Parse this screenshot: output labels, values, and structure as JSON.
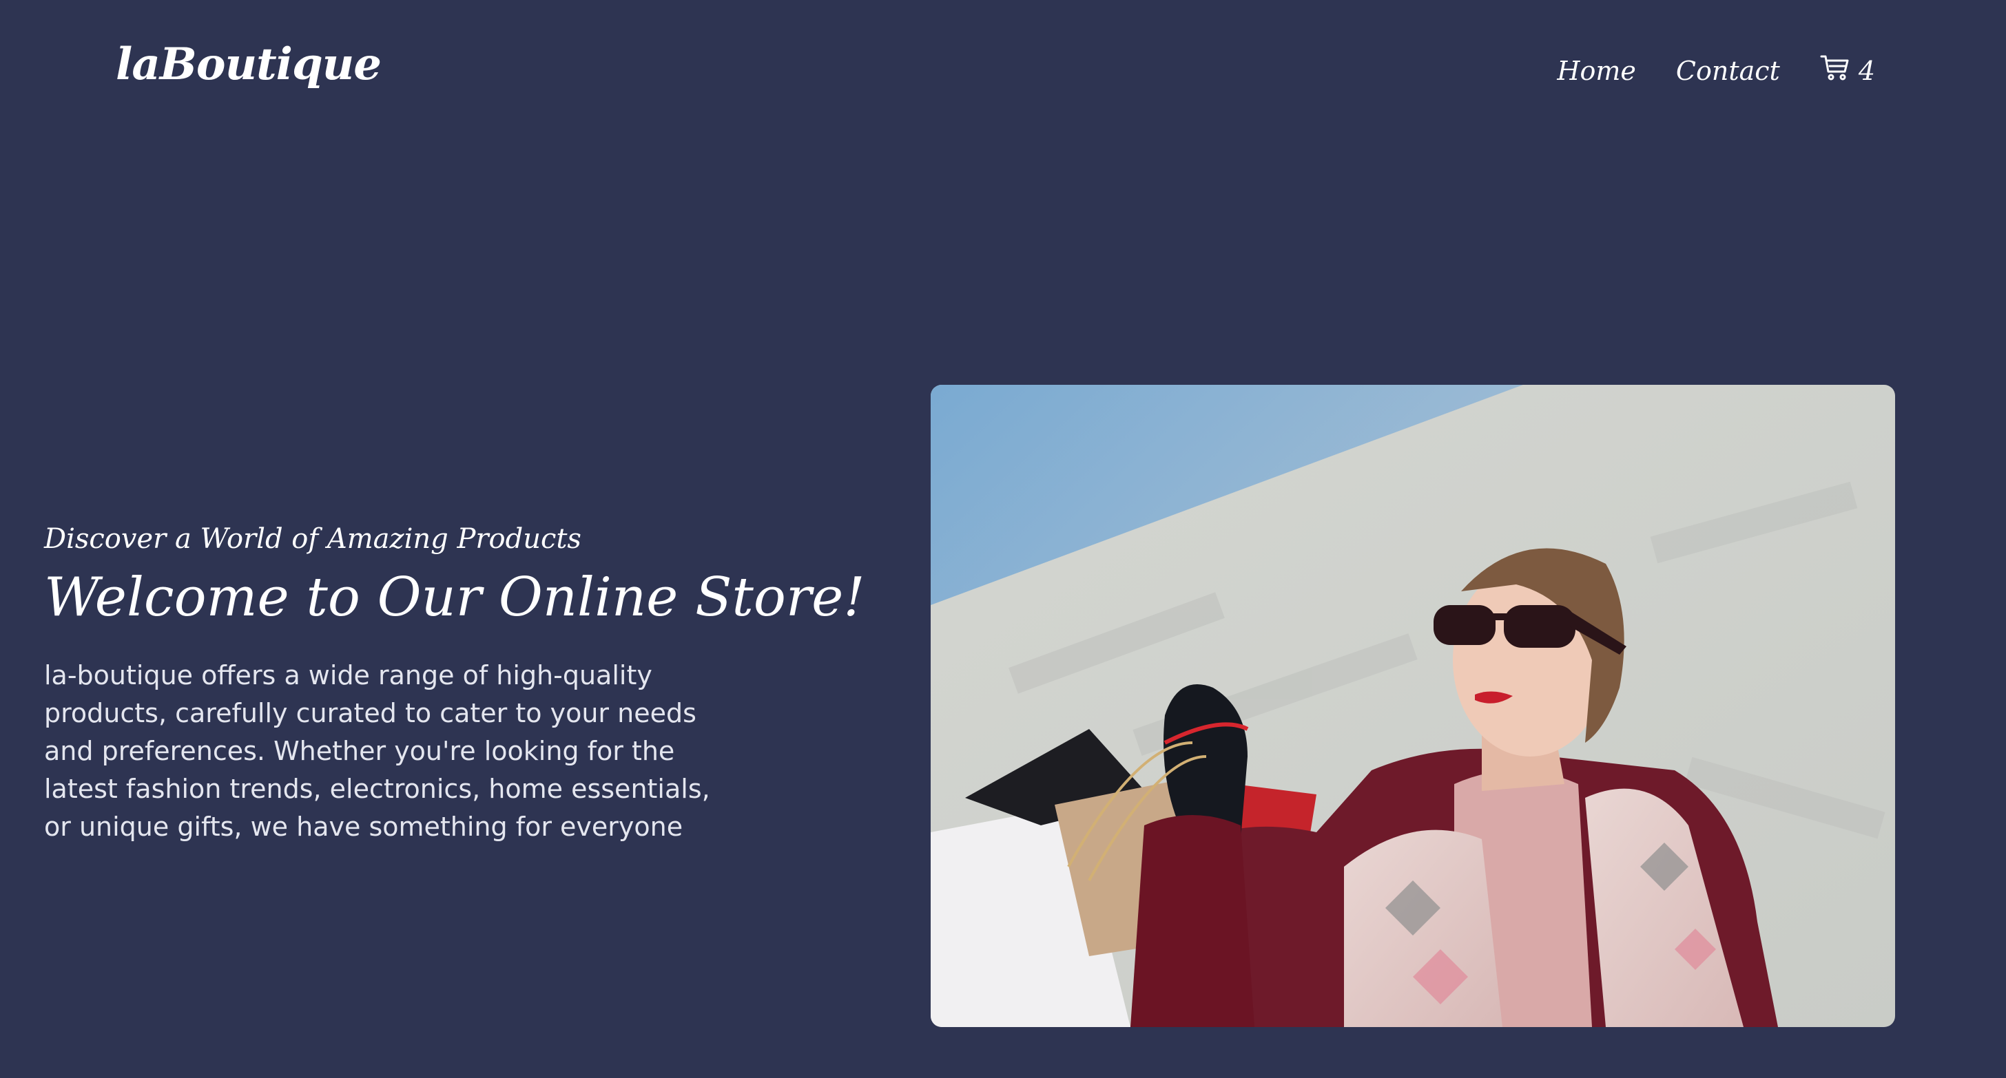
{
  "header": {
    "logo": "laBoutique",
    "nav": {
      "home": "Home",
      "contact": "Contact",
      "cart_count": "4"
    }
  },
  "hero": {
    "kicker": "Discover a World of Amazing Products",
    "title": "Welcome to Our Online Store!",
    "description": "la-boutique offers a wide range of high-quality products, carefully curated to cater to your needs and preferences. Whether you're looking for the latest fashion trends, electronics, home essentials, or unique gifts, we have something for everyone",
    "image": {
      "subject": "woman-with-shopping-bags"
    }
  },
  "colors": {
    "background": "#2e3452",
    "text": "#ffffff",
    "muted_text": "#e4e6ef"
  },
  "icons": {
    "cart": "shopping-cart-icon"
  }
}
